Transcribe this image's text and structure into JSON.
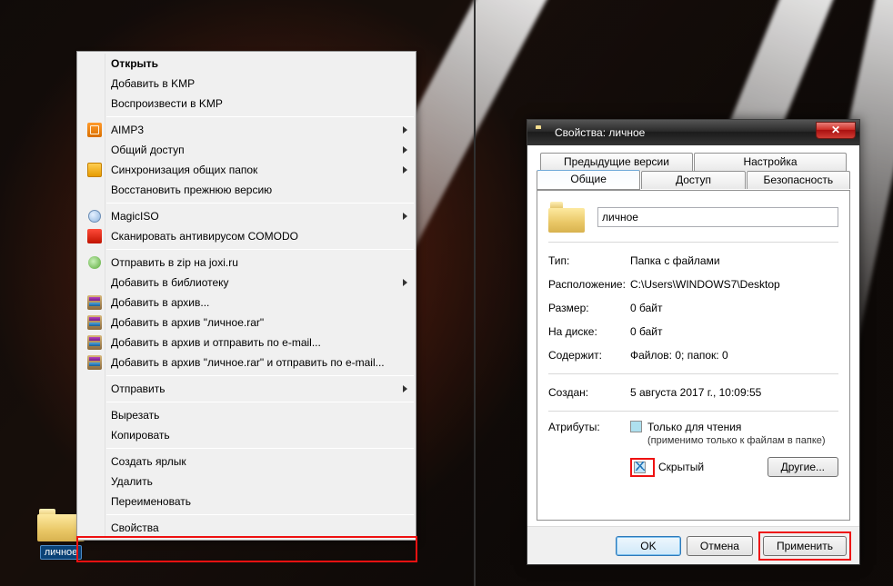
{
  "desktop": {
    "folder_label": "личное"
  },
  "menu": {
    "open": "Открыть",
    "add_kmp": "Добавить в KMP",
    "play_kmp": "Воспроизвести в KMP",
    "aimp3": "AIMP3",
    "share": "Общий доступ",
    "sync_shared": "Синхронизация общих папок",
    "restore_prev": "Восстановить прежнюю версию",
    "magiciso": "MagicISO",
    "scan_comodo": "Сканировать антивирусом COMODO",
    "send_zip_joxi": "Отправить в zip на joxi.ru",
    "add_library": "Добавить в библиотеку",
    "add_archive": "Добавить в архив...",
    "add_archive_name": "Добавить в архив \"личное.rar\"",
    "add_archive_email": "Добавить в архив и отправить по e-mail...",
    "add_archive_name_email": "Добавить в архив \"личное.rar\" и отправить по e-mail...",
    "send_to": "Отправить",
    "cut": "Вырезать",
    "copy": "Копировать",
    "create_shortcut": "Создать ярлык",
    "delete": "Удалить",
    "rename": "Переименовать",
    "properties": "Свойства"
  },
  "dlg": {
    "title": "Свойства: личное",
    "tabs": {
      "prev": "Предыдущие версии",
      "customize": "Настройка",
      "general": "Общие",
      "sharing": "Доступ",
      "security": "Безопасность"
    },
    "name_value": "личное",
    "labels": {
      "type": "Тип:",
      "location": "Расположение:",
      "size": "Размер:",
      "size_on_disk": "На диске:",
      "contains": "Содержит:",
      "created": "Создан:",
      "attributes": "Атрибуты:"
    },
    "values": {
      "type": "Папка с файлами",
      "location": "C:\\Users\\WINDOWS7\\Desktop",
      "size": "0 байт",
      "size_on_disk": "0 байт",
      "contains": "Файлов: 0; папок: 0",
      "created": "5 августа 2017 г., 10:09:55"
    },
    "readonly": "Только для чтения",
    "readonly_note": "(применимо только к файлам в папке)",
    "hidden": "Скрытый",
    "other": "Другие...",
    "ok": "OK",
    "cancel": "Отмена",
    "apply": "Применить"
  }
}
